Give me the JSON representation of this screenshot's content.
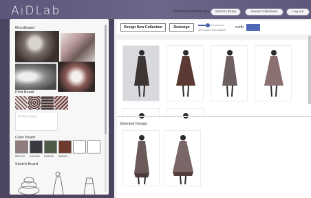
{
  "app": {
    "logo": "AiDLab"
  },
  "header": {
    "welcome": "Welcome Aemika Zou",
    "sketch_library": "Sketch Library",
    "saved_collections": "Saved Collections",
    "logout": "Log out"
  },
  "sidebar": {
    "moodboard_label": "Moodboard",
    "printboard_label": "Print Board",
    "print_placeholder": "Print(png,jpg)",
    "colorboard_label": "Color Board",
    "sketchboard_label": "Sketch Board",
    "colors": [
      {
        "hex": "#8f7d7d",
        "label": "#8f7d7d"
      },
      {
        "hex": "#3b3a40",
        "label": "#3b3a40"
      },
      {
        "hex": "#4f5b46",
        "label": "#4f5b46"
      },
      {
        "hex": "#6f3a2e",
        "label": "#6f3a2e"
      },
      {
        "hex": "#ffffff",
        "label": ""
      },
      {
        "hex": "#ffffff",
        "label": ""
      }
    ]
  },
  "toolbar": {
    "design_new_collection": "Design New Collection",
    "redesign": "Redesign",
    "slider_caption": "20% given from spawn",
    "slider_value": 0.35,
    "outfit_label": "outfit",
    "outfit_color": "#5069b6"
  },
  "generated": {
    "cards": [
      {
        "selected": true
      },
      {
        "selected": false
      },
      {
        "selected": false
      },
      {
        "selected": false
      },
      {
        "selected": false
      },
      {
        "selected": false
      }
    ]
  },
  "selected_panel": {
    "title": "Selected Design"
  }
}
